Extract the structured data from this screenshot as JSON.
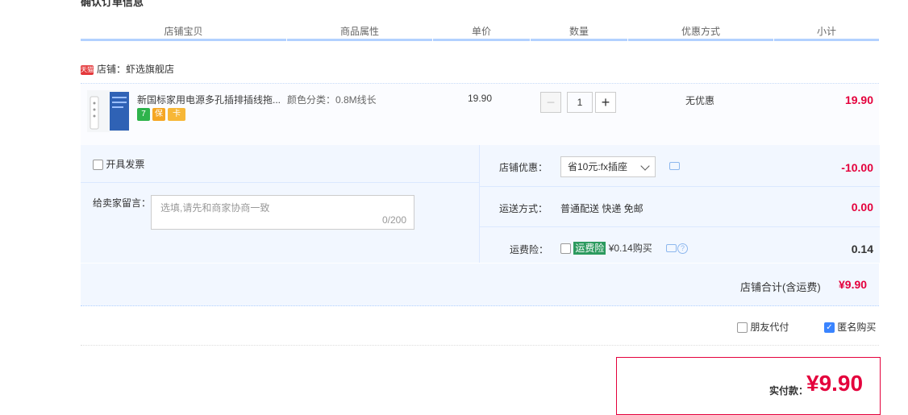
{
  "section_title": "确认订单信息",
  "columns": [
    "店铺宝贝",
    "商品属性",
    "单价",
    "数量",
    "优惠方式",
    "小计"
  ],
  "shop": {
    "badge": "天猫",
    "name": "店铺：虾选旗舰店"
  },
  "item": {
    "title": "新国标家用电源多孔插排插线拖...",
    "attribute": "颜色分类：0.8M线长",
    "price": "19.90",
    "quantity": "1",
    "discount": "无优惠",
    "subtotal": "19.90",
    "tags": [
      "7",
      "保",
      "卡"
    ]
  },
  "invoice": {
    "label": "开具发票"
  },
  "message": {
    "label": "给卖家留言：",
    "placeholder": "选填,请先和商家协商一致",
    "count": "0/200"
  },
  "shop_coupon": {
    "label": "店铺优惠：",
    "value": "省10元:fx插座",
    "amount": "-10.00"
  },
  "shipping": {
    "label": "运送方式：",
    "value": "普通配送 快递 免邮",
    "amount": "0.00"
  },
  "insurance": {
    "label": "运费险：",
    "badge": "运费险",
    "text": "¥0.14购买",
    "amount": "0.14",
    "help": "?"
  },
  "shop_total": {
    "label": "店铺合计(含运费)",
    "value": "¥9.90"
  },
  "options": {
    "friend_pay": "朋友代付",
    "anonymous": "匿名购买",
    "anonymous_checked": true
  },
  "payment": {
    "label": "实付款：",
    "value": "¥9.90"
  },
  "colors": {
    "accent": "#e4003c",
    "header_bar": "#b2d1ff",
    "panel": "#f2f7ff"
  }
}
